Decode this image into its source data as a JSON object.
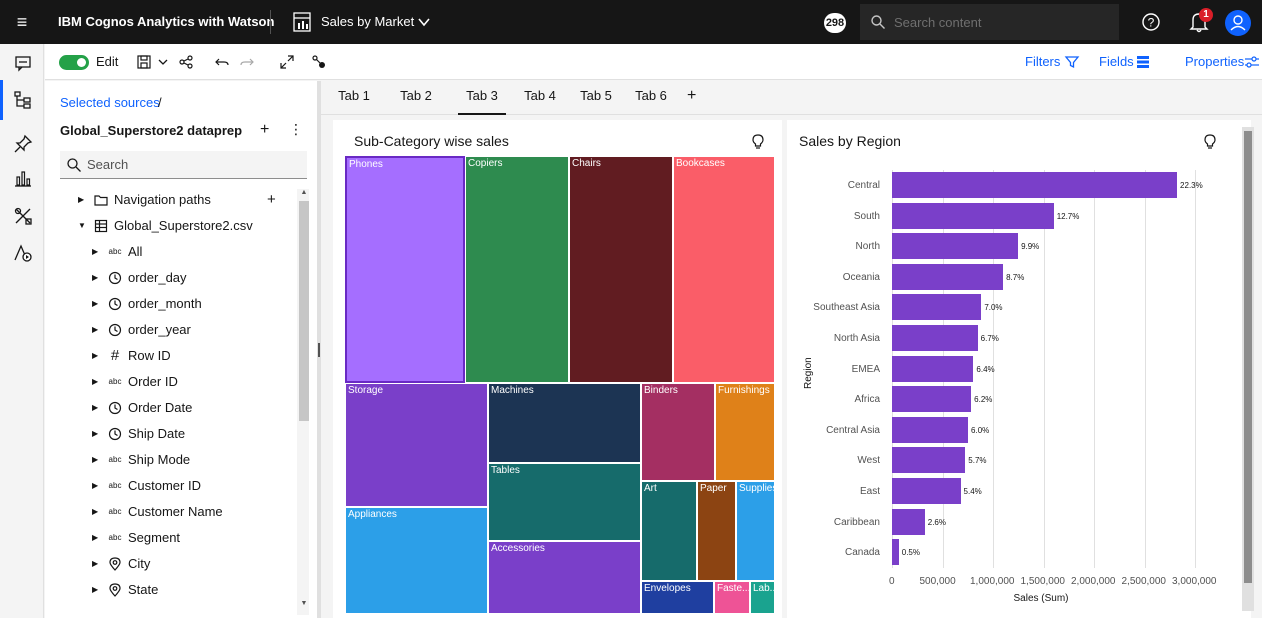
{
  "header": {
    "brand": "IBM Cognos Analytics with Watson",
    "report_title": "Sales by Market",
    "badge": "298",
    "search_placeholder": "Search content",
    "notification_count": "1"
  },
  "toolbar": {
    "edit_label": "Edit",
    "filters_label": "Filters",
    "fields_label": "Fields",
    "properties_label": "Properties"
  },
  "sources": {
    "breadcrumb": "Selected sources",
    "breadcrumb_sep": "/",
    "datasource_title": "Global_Superstore2 dataprep",
    "search_placeholder": "Search",
    "tree": [
      {
        "label": "Navigation paths",
        "icon": "folder-icon",
        "type": "folder"
      },
      {
        "label": "Global_Superstore2.csv",
        "icon": "table-icon",
        "type": "table"
      },
      {
        "label": "All",
        "icon": "abc",
        "type": "text"
      },
      {
        "label": "order_day",
        "icon": "clock-icon",
        "type": "time"
      },
      {
        "label": "order_month",
        "icon": "clock-icon",
        "type": "time"
      },
      {
        "label": "order_year",
        "icon": "clock-icon",
        "type": "time"
      },
      {
        "label": "Row ID",
        "icon": "#",
        "type": "number"
      },
      {
        "label": "Order ID",
        "icon": "abc",
        "type": "text"
      },
      {
        "label": "Order Date",
        "icon": "clock-icon",
        "type": "time"
      },
      {
        "label": "Ship Date",
        "icon": "clock-icon",
        "type": "time"
      },
      {
        "label": "Ship Mode",
        "icon": "abc",
        "type": "text"
      },
      {
        "label": "Customer ID",
        "icon": "abc",
        "type": "text"
      },
      {
        "label": "Customer Name",
        "icon": "abc",
        "type": "text"
      },
      {
        "label": "Segment",
        "icon": "abc",
        "type": "text"
      },
      {
        "label": "City",
        "icon": "location-icon",
        "type": "geo"
      },
      {
        "label": "State",
        "icon": "location-icon",
        "type": "geo"
      }
    ]
  },
  "tabs": [
    "Tab 1",
    "Tab 2",
    "Tab 3",
    "Tab 4",
    "Tab 5",
    "Tab 6"
  ],
  "active_tab": "Tab 3",
  "treemap_card": {
    "title": "Sub-Category wise sales",
    "cells": [
      {
        "label": "Phones",
        "color": "#a56eff"
      },
      {
        "label": "Copiers",
        "color": "#2e8b4f"
      },
      {
        "label": "Chairs",
        "color": "#611c21"
      },
      {
        "label": "Bookcases",
        "color": "#fa5d68"
      },
      {
        "label": "Storage",
        "color": "#7a3fc9"
      },
      {
        "label": "Machines",
        "color": "#1c3453"
      },
      {
        "label": "Binders",
        "color": "#a42f62"
      },
      {
        "label": "Furnishings",
        "color": "#df8119"
      },
      {
        "label": "Tables",
        "color": "#166b6b"
      },
      {
        "label": "Appliances",
        "color": "#2c9fe8"
      },
      {
        "label": "Art",
        "color": "#166b6b"
      },
      {
        "label": "Paper",
        "color": "#8c4412"
      },
      {
        "label": "Supplies",
        "color": "#2c9fe8"
      },
      {
        "label": "Accessories",
        "color": "#7a3fc9"
      },
      {
        "label": "Envelopes",
        "color": "#1f3fa0"
      },
      {
        "label": "Faste...",
        "color": "#ee5396"
      },
      {
        "label": "Lab...",
        "color": "#1aa38f"
      }
    ]
  },
  "bar_card": {
    "title": "Sales by Region"
  },
  "chart_data": {
    "type": "bar",
    "orientation": "horizontal",
    "title": "Sales by Region",
    "xlabel": "Sales (Sum)",
    "ylabel": "Region",
    "categories": [
      "Central",
      "South",
      "North",
      "Oceania",
      "Southeast Asia",
      "North Asia",
      "EMEA",
      "Africa",
      "Central Asia",
      "West",
      "East",
      "Caribbean",
      "Canada"
    ],
    "values": [
      2822303,
      1600907,
      1248166,
      1100185,
      884423,
      848310,
      806162,
      783773,
      752827,
      725458,
      678781,
      324281,
      66928
    ],
    "data_labels": [
      "22.3%",
      "12.7%",
      "9.9%",
      "8.7%",
      "7.0%",
      "6.7%",
      "6.4%",
      "6.2%",
      "6.0%",
      "5.7%",
      "5.4%",
      "2.6%",
      "0.5%"
    ],
    "xticks": [
      "0",
      "500,000",
      "1,000,000",
      "1,500,000",
      "2,000,000",
      "2,500,000",
      "3,000,000"
    ],
    "xlim": [
      0,
      3000000
    ],
    "grid": true,
    "color": "#7a3fc9"
  }
}
